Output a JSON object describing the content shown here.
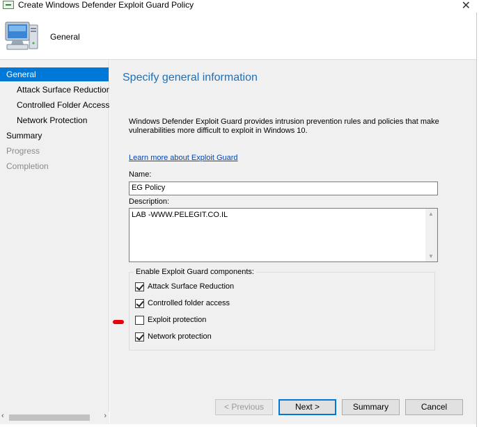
{
  "window": {
    "title": "Create Windows Defender Exploit Guard Policy",
    "close_glyph": "✕"
  },
  "header": {
    "title": "General",
    "icon": "computer-icon"
  },
  "nav": {
    "items": [
      {
        "label": "General",
        "state": "active"
      },
      {
        "label": "Attack Surface Reduction",
        "state": "normal"
      },
      {
        "label": "Controlled Folder Access",
        "state": "normal"
      },
      {
        "label": "Network Protection",
        "state": "normal"
      },
      {
        "label": "Summary",
        "state": "normal"
      },
      {
        "label": "Progress",
        "state": "disabled"
      },
      {
        "label": "Completion",
        "state": "disabled"
      }
    ]
  },
  "content": {
    "section_title": "Specify general information",
    "description": "Windows Defender Exploit Guard provides intrusion prevention rules and policies that make vulnerabilities more difficult to exploit in Windows 10.",
    "learn_more_link": "Learn more about Exploit Guard",
    "name_label": "Name:",
    "name_value": "EG Policy",
    "description_label": "Description:",
    "description_value": "LAB -WWW.PELEGIT.CO.IL",
    "components_label": "Enable Exploit Guard components:",
    "components": [
      {
        "label": "Attack Surface Reduction",
        "checked": true
      },
      {
        "label": "Controlled folder access",
        "checked": true
      },
      {
        "label": "Exploit protection",
        "checked": false
      },
      {
        "label": "Network protection",
        "checked": true
      }
    ]
  },
  "buttons": {
    "previous": "< Previous",
    "next": "Next >",
    "summary": "Summary",
    "cancel": "Cancel"
  },
  "colors": {
    "accent": "#0078d7",
    "title_blue": "#1e6fb8",
    "annotation_red": "#e8000b"
  }
}
